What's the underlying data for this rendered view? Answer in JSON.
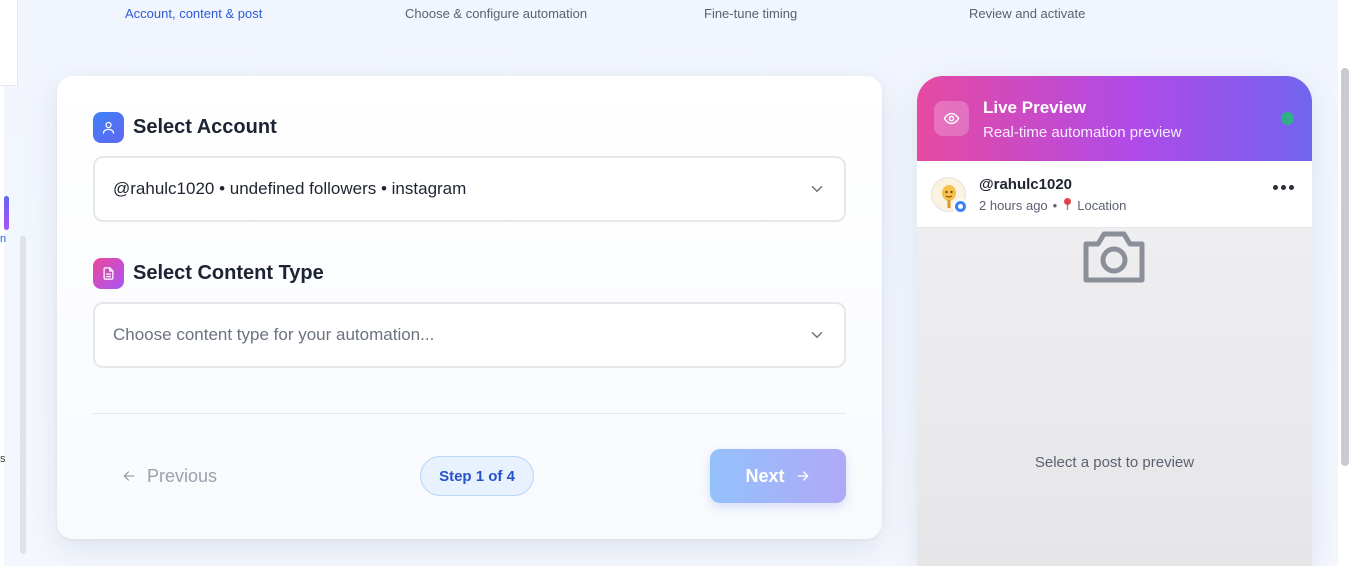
{
  "stepper": {
    "steps": [
      {
        "label": "Account, content & post",
        "active": true
      },
      {
        "label": "Choose & configure automation",
        "active": false
      },
      {
        "label": "Fine-tune timing",
        "active": false
      },
      {
        "label": "Review and activate",
        "active": false
      }
    ]
  },
  "left_fragments": {
    "frag1": "n",
    "frag2": "s"
  },
  "form": {
    "account_section_title": "Select Account",
    "account_value": "@rahulc1020 • undefined followers • instagram",
    "content_section_title": "Select Content Type",
    "content_placeholder": "Choose content type for your automation...",
    "previous_label": "Previous",
    "step_indicator": "Step 1 of 4",
    "next_label": "Next"
  },
  "preview": {
    "title": "Live Preview",
    "subtitle": "Real-time automation preview",
    "username": "@rahulc1020",
    "time": "2 hours ago",
    "separator": "•",
    "location": "Location",
    "empty_text": "Select a post to preview"
  },
  "icons": {
    "account": "user-icon",
    "content": "document-icon",
    "preview": "eye-icon",
    "empty": "camera-icon",
    "more": "more-horizontal-icon",
    "location": "pin-icon"
  },
  "colors": {
    "accent": "#2f5bd6",
    "preview_gradient_start": "#e64aa1",
    "preview_gradient_end": "#7165ee",
    "live_dot": "#2fae87"
  }
}
